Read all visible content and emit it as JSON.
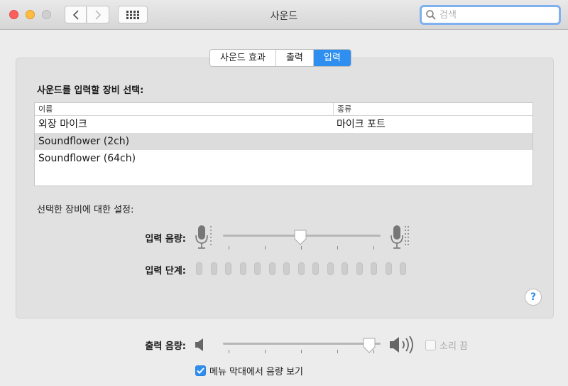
{
  "window": {
    "title": "사운드"
  },
  "search": {
    "placeholder": "검색"
  },
  "tabs": [
    {
      "label": "사운드 효과",
      "active": false
    },
    {
      "label": "출력",
      "active": false
    },
    {
      "label": "입력",
      "active": true
    }
  ],
  "input": {
    "section_title": "사운드를 입력할 장비 선택:",
    "columns": {
      "name": "이름",
      "type": "종류"
    },
    "devices": [
      {
        "name": "외장 마이크",
        "type": "마이크 포트",
        "selected": false
      },
      {
        "name": "Soundflower (2ch)",
        "type": "",
        "selected": true
      },
      {
        "name": "Soundflower (64ch)",
        "type": "",
        "selected": false
      }
    ],
    "settings_title": "선택한 장비에 대한 설정:",
    "volume_label": "입력 음량:",
    "volume_level": 0.49,
    "level_label": "입력 단계:",
    "level_bars": 15
  },
  "help_label": "?",
  "output": {
    "volume_label": "출력 음량:",
    "volume_level": 0.93,
    "mute_label": "소리 끔",
    "mute_checked": false,
    "menubar_label": "메뉴 막대에서 음량 보기",
    "menubar_checked": true
  },
  "colors": {
    "accent": "#2e8ff0",
    "close": "#fc605c",
    "minimize": "#fdbc40"
  }
}
